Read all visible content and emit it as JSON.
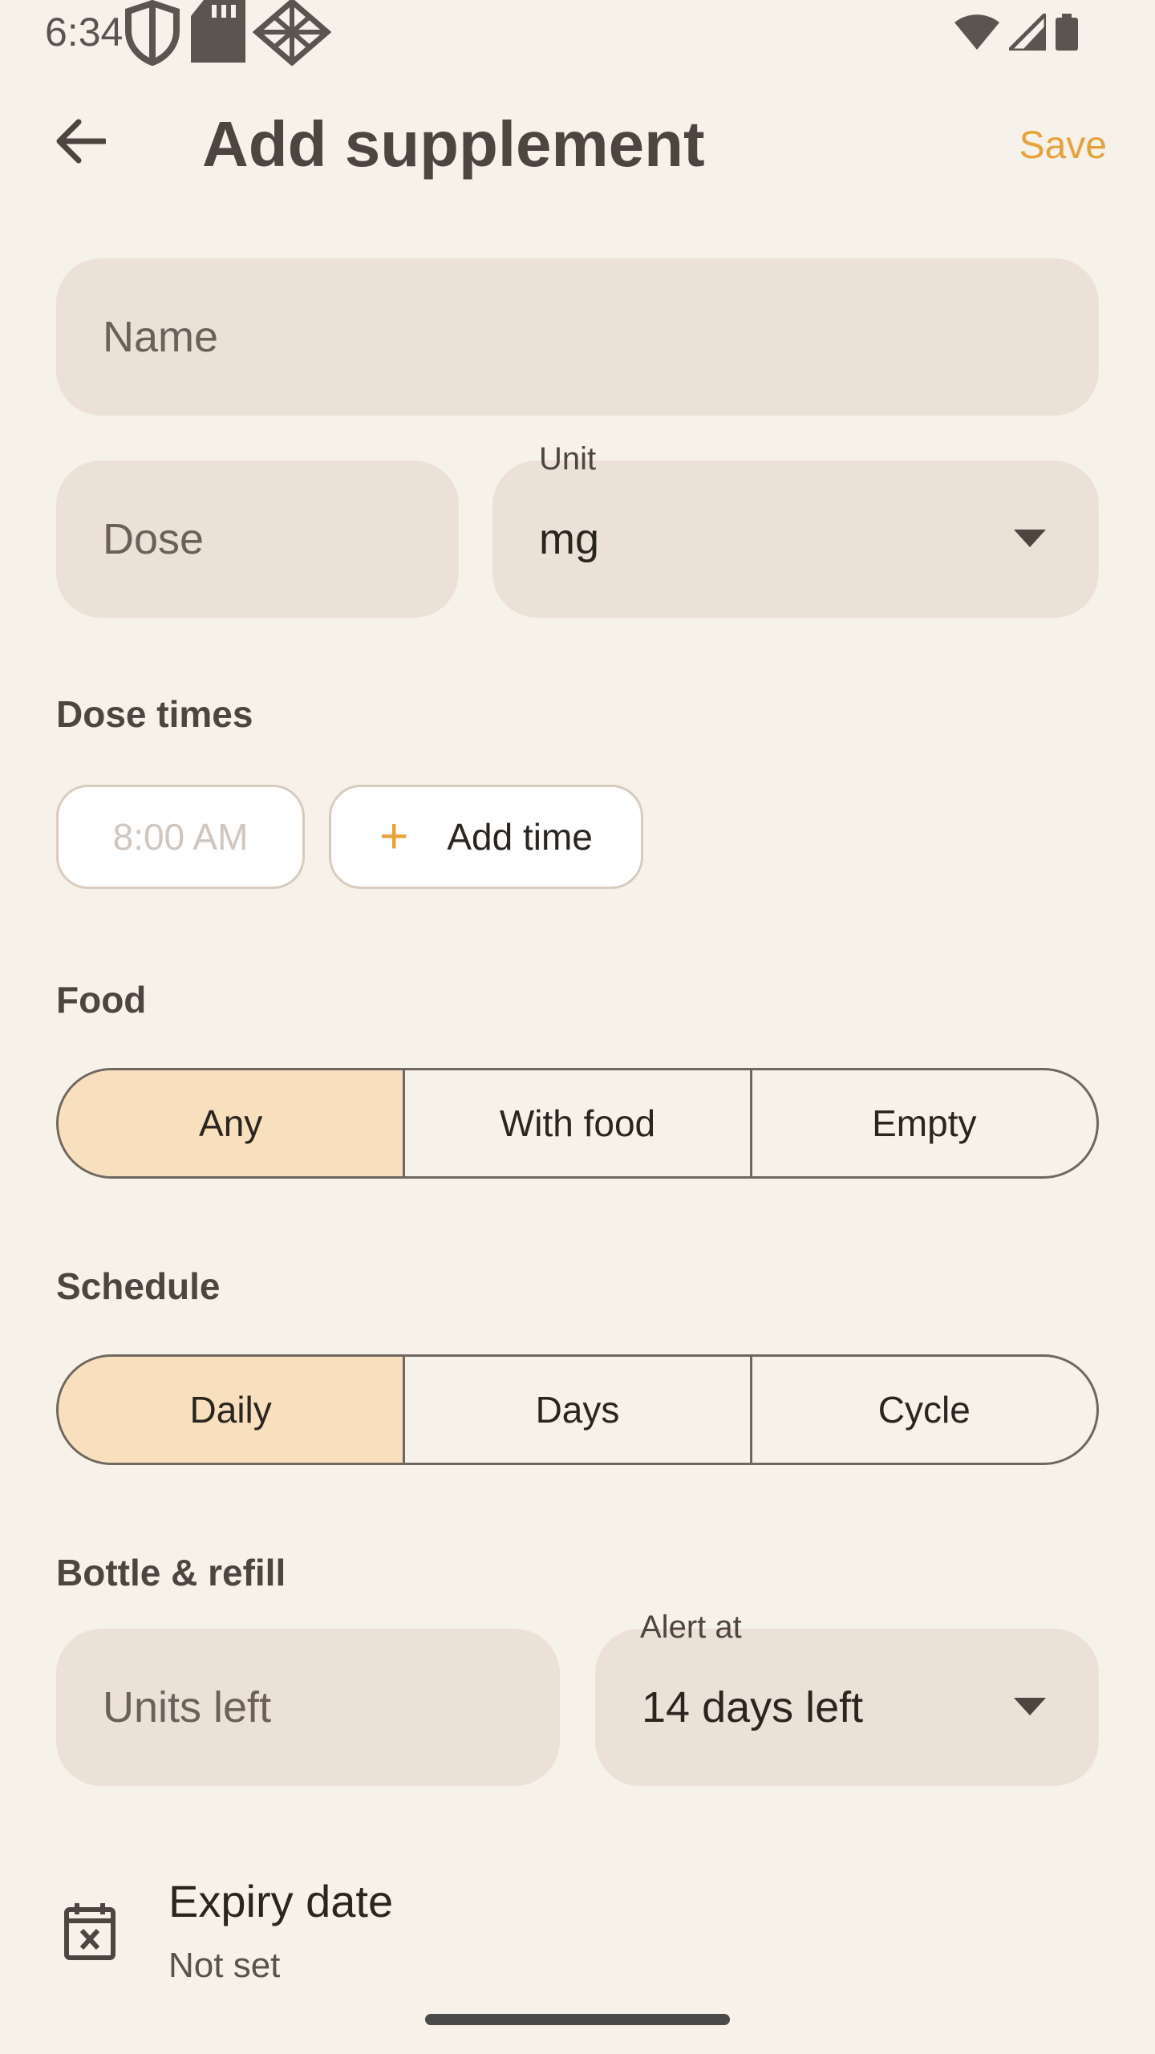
{
  "status_bar": {
    "time": "6:34"
  },
  "app_bar": {
    "title": "Add supplement",
    "save_label": "Save"
  },
  "fields": {
    "name_placeholder": "Name",
    "dose_placeholder": "Dose",
    "unit_label": "Unit",
    "unit_value": "mg"
  },
  "dose_times": {
    "label": "Dose times",
    "time_chip": "8:00 AM",
    "add_label": "Add time"
  },
  "food": {
    "label": "Food",
    "options": [
      "Any",
      "With food",
      "Empty"
    ],
    "selected": "Any"
  },
  "schedule": {
    "label": "Schedule",
    "options": [
      "Daily",
      "Days",
      "Cycle"
    ],
    "selected": "Daily"
  },
  "bottle": {
    "label": "Bottle & refill",
    "units_placeholder": "Units left",
    "alert_label": "Alert at",
    "alert_value": "14 days left"
  },
  "expiry": {
    "title": "Expiry date",
    "value": "Not set"
  },
  "colors": {
    "background": "#f6f1e9",
    "accent": "#e6a23c",
    "field_fill": "#ece1d7",
    "segment_selected": "#f8dfbd"
  },
  "icons": [
    "back-arrow-icon",
    "shield-icon",
    "sd-card-icon",
    "network-icon",
    "wifi-icon",
    "signal-icon",
    "battery-icon",
    "plus-icon",
    "dropdown-icon",
    "calendar-clear-icon"
  ]
}
